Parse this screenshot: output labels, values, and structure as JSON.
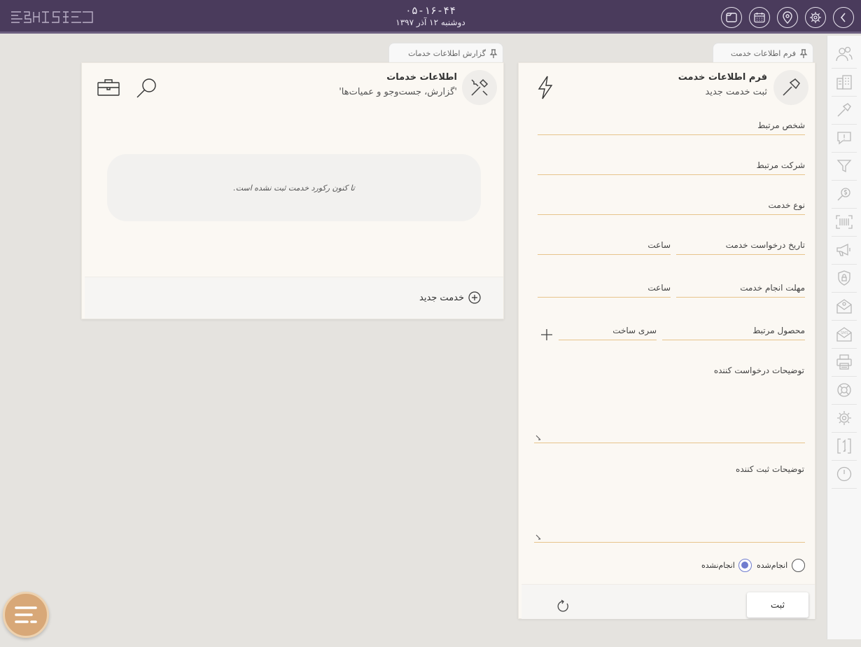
{
  "header": {
    "time": "۰۵-۱۶-۴۴",
    "date": "دوشنبه ۱۲ آذر ۱۳۹۷",
    "icons": [
      "back-chevron-icon",
      "settings-gear-icon",
      "location-pin-icon",
      "calendar-icon",
      "window-icon"
    ]
  },
  "sidebar": {
    "items": [
      "people-icon",
      "building-icon",
      "hammer-icon",
      "comment-alert-icon",
      "filter-icon",
      "money-search-icon",
      "barcode-scan-icon",
      "megaphone-icon",
      "security-lock-icon",
      "email-icon",
      "sms-icon",
      "printer-icon",
      "lifebuoy-icon",
      "gear-icon",
      "transfer-icon",
      "power-icon"
    ]
  },
  "report": {
    "tab_label": "گزارش اطلاعات خدمات",
    "title": "اطلاعات خدمات",
    "subtitle": "'گزارش، جست‌وجو و عمیات‌ها'",
    "empty_message": "تا کنون رکورد خدمت ثبت نشده است.",
    "new_service_label": "خدمت جدید"
  },
  "form": {
    "tab_label": "فرم اطلاعات خدمت",
    "title": "فرم اطلاعات خدمت",
    "subtitle": "ثبت خدمت جدید",
    "fields": {
      "person": "شخص مرتبط",
      "company": "شرکت مرتبط",
      "service_type": "نوع خدمت",
      "request_date": "تاریخ درخواست خدمت",
      "request_time": "ساعت",
      "deadline": "مهلت انجام خدمت",
      "deadline_time": "ساعت",
      "product": "محصول مرتبط",
      "serial": "سری ساخت",
      "requester_notes": "توضیحات درخواست کننده",
      "registrar_notes": "توضیحات ثبت کننده"
    },
    "status": {
      "done_label": "انجام‌شده",
      "not_done_label": "انجام‌نشده",
      "selected": "انجام‌نشده"
    },
    "submit_label": "ثبت"
  },
  "colors": {
    "header_bg": "#4a3b5c",
    "field_underline": "#e7c48c",
    "radio_accent": "#6f7ccf",
    "fab_bg": "#d8a878"
  }
}
